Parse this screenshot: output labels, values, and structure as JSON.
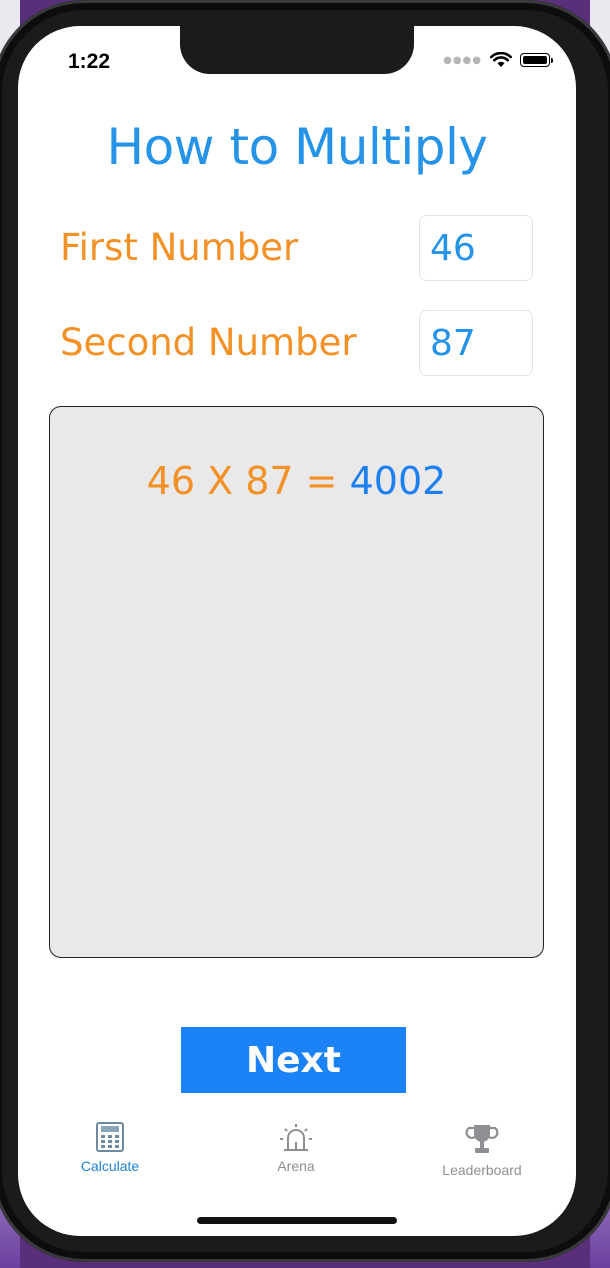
{
  "status_bar": {
    "time": "1:22",
    "signal_icon": "signal-dots-icon",
    "wifi_icon": "wifi-icon",
    "battery_icon": "battery-icon"
  },
  "title": "How to Multiply",
  "first_number": {
    "label": "First Number",
    "value": "46"
  },
  "second_number": {
    "label": "Second Number",
    "value": "87"
  },
  "result": {
    "expression": "46 X 87 =",
    "answer": "4002"
  },
  "next_button": {
    "label": "Next"
  },
  "tabs": [
    {
      "label": "Calculate",
      "icon": "calculator-icon",
      "active": true
    },
    {
      "label": "Arena",
      "icon": "arena-icon",
      "active": false
    },
    {
      "label": "Leaderboard",
      "icon": "trophy-icon",
      "active": false
    }
  ],
  "colors": {
    "title_blue": "#2493e8",
    "label_orange": "#f39126",
    "button_blue": "#1b82f7",
    "result_box_bg": "#e9e9e9",
    "tab_active": "#1f82d6",
    "tab_inactive": "#8e8e93"
  }
}
